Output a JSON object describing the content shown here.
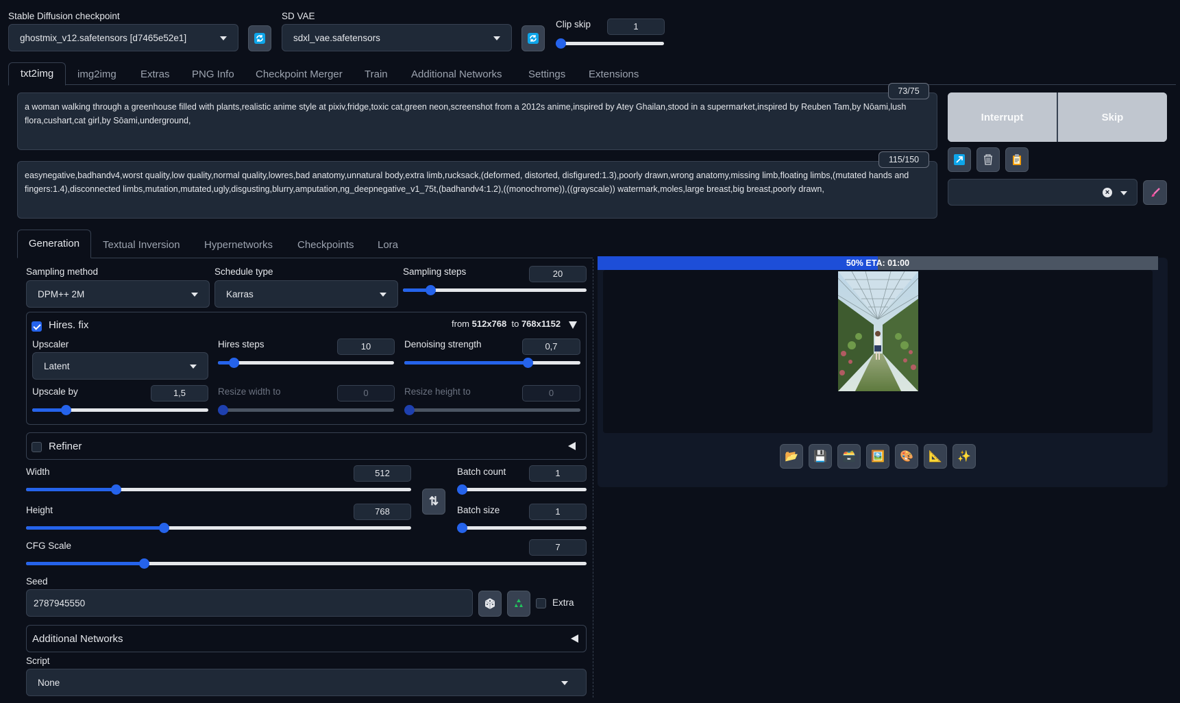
{
  "top": {
    "checkpoint_label": "Stable Diffusion checkpoint",
    "checkpoint_value": "ghostmix_v12.safetensors [d7465e52e1]",
    "vae_label": "SD VAE",
    "vae_value": "sdxl_vae.safetensors",
    "clip_skip_label": "Clip skip",
    "clip_skip_value": "1",
    "clip_skip_fraction": 0.0
  },
  "main_tabs": [
    "txt2img",
    "img2img",
    "Extras",
    "PNG Info",
    "Checkpoint Merger",
    "Train",
    "Additional Networks",
    "Settings",
    "Extensions"
  ],
  "prompt": {
    "text": "a woman walking through a greenhouse filled with plants,realistic anime style at pixiv,fridge,toxic cat,green neon,screenshot from a 2012s anime,inspired by Atey Ghailan,stood in a supermarket,inspired by Reuben Tam,by Nōami,lush flora,cushart,cat girl,by Sōami,underground,",
    "token_count": "73/75"
  },
  "negative_prompt": {
    "text": "easynegative,badhandv4,worst quality,low quality,normal quality,lowres,bad anatomy,unnatural body,extra limb,rucksack,(deformed, distorted, disfigured:1.3),poorly drawn,wrong anatomy,missing limb,floating limbs,(mutated hands and fingers:1.4),disconnected limbs,mutation,mutated,ugly,disgusting,blurry,amputation,ng_deepnegative_v1_75t,(badhandv4:1.2),((monochrome)),((grayscale)) watermark,moles,large breast,big breast,poorly drawn,",
    "token_count": "115/150"
  },
  "actions": {
    "interrupt": "Interrupt",
    "skip": "Skip"
  },
  "sub_tabs": [
    "Generation",
    "Textual Inversion",
    "Hypernetworks",
    "Checkpoints",
    "Lora"
  ],
  "generation": {
    "sampling_method_label": "Sampling method",
    "sampling_method_value": "DPM++ 2M",
    "schedule_type_label": "Schedule type",
    "schedule_type_value": "Karras",
    "sampling_steps_label": "Sampling steps",
    "sampling_steps_value": "20",
    "sampling_steps_fraction": 0.15,
    "hires": {
      "label": "Hires. fix",
      "checked": true,
      "from_prefix": "from",
      "from_size": "512x768",
      "to_prefix": "to",
      "to_size": "768x1152",
      "upscaler_label": "Upscaler",
      "upscaler_value": "Latent",
      "hires_steps_label": "Hires steps",
      "hires_steps_value": "10",
      "hires_steps_fraction": 0.09,
      "denoise_label": "Denoising strength",
      "denoise_value": "0,7",
      "denoise_fraction": 0.7,
      "upscale_by_label": "Upscale by",
      "upscale_by_value": "1,5",
      "upscale_by_fraction": 0.19,
      "resize_w_label": "Resize width to",
      "resize_w_value": "0",
      "resize_h_label": "Resize height to",
      "resize_h_value": "0"
    },
    "refiner_label": "Refiner",
    "width_label": "Width",
    "width_value": "512",
    "width_fraction": 0.233,
    "height_label": "Height",
    "height_value": "768",
    "height_fraction": 0.358,
    "batch_count_label": "Batch count",
    "batch_count_value": "1",
    "batch_count_fraction": 0.0,
    "batch_size_label": "Batch size",
    "batch_size_value": "1",
    "batch_size_fraction": 0.0,
    "cfg_label": "CFG Scale",
    "cfg_value": "7",
    "cfg_fraction": 0.21,
    "seed_label": "Seed",
    "seed_value": "2787945550",
    "extra_label": "Extra",
    "additional_networks_label": "Additional Networks",
    "script_label": "Script",
    "script_value": "None"
  },
  "output": {
    "progress_text": "50% ETA: 01:00",
    "progress_fraction": 0.5
  },
  "colors": {
    "background": "#0b0f19",
    "accent": "#2563eb",
    "panel": "#1f2937"
  }
}
